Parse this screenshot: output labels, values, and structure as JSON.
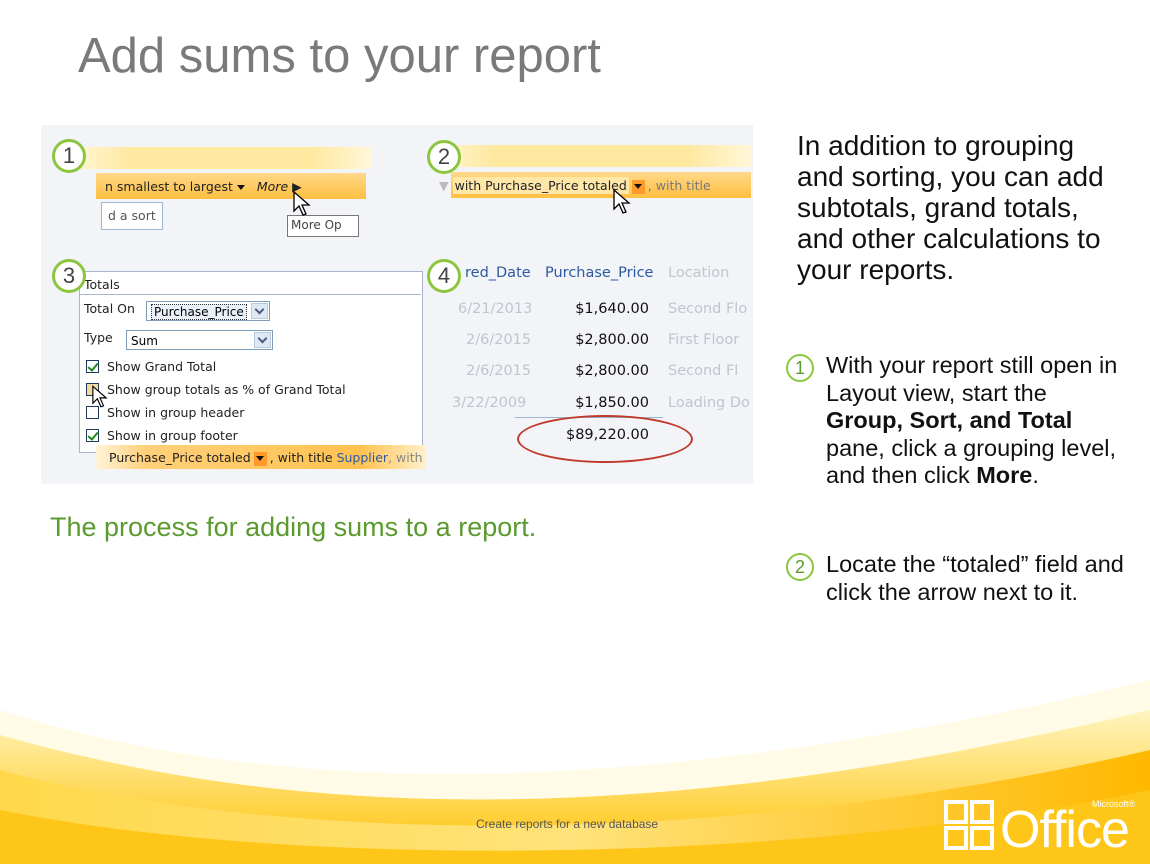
{
  "title": "Add sums to your report",
  "collage": {
    "badges": [
      "1",
      "2",
      "3",
      "4"
    ],
    "panel1": {
      "sort_text": "n smallest to largest",
      "more_text": "More",
      "add_sort": "d a sort",
      "tooltip": "More Op"
    },
    "panel2": {
      "totaled_text": "with Purchase_Price totaled",
      "with_title": ", with title"
    },
    "panel3": {
      "header": "Totals",
      "total_on_label": "Total On",
      "total_on_value": "Purchase_Price",
      "type_label": "Type",
      "type_value": "Sum",
      "checkboxes": [
        {
          "label": "Show Grand Total",
          "checked": true
        },
        {
          "label": "Show group totals as % of Grand Total",
          "checked": false
        },
        {
          "label": "Show in group header",
          "checked": false
        },
        {
          "label": "Show in group footer",
          "checked": true
        }
      ],
      "bottom_bar": "Purchase_Price totaled",
      "bottom_with_title": ", with title",
      "bottom_supplier": "Supplier",
      "bottom_with": ", with"
    },
    "panel4": {
      "headers": [
        "red_Date",
        "Purchase_Price",
        "Location"
      ],
      "rows": [
        {
          "date": "6/21/2013",
          "price": "$1,640.00",
          "loc": "Second Flo"
        },
        {
          "date": "2/6/2015",
          "price": "$2,800.00",
          "loc": "First Floor"
        },
        {
          "date": "2/6/2015",
          "price": "$2,800.00",
          "loc": "Second Fl"
        },
        {
          "date": "3/22/2009",
          "price": "$1,850.00",
          "loc": "Loading Do"
        }
      ],
      "total": "$89,220.00"
    }
  },
  "caption": "The process for adding sums to a report.",
  "intro": "In addition to grouping and sorting, you can add subtotals, grand totals, and other calculations to your reports.",
  "steps": [
    {
      "num": "1",
      "pre": "With your report still open in Layout view, start the ",
      "bold1": "Group, Sort, and Total",
      "mid": " pane, click a grouping level, and then click ",
      "bold2": "More",
      "post": "."
    },
    {
      "num": "2",
      "text": "Locate the “totaled” field and click the arrow next to it."
    }
  ],
  "footer": "Create reports for a new database",
  "logo": {
    "text": "Office",
    "ms": "Microsoft®"
  },
  "colors": {
    "accent_green": "#8cc63e",
    "caption_green": "#5a9a2e",
    "title_gray": "#7a7a7a",
    "wave_orange": "#ffc000"
  }
}
